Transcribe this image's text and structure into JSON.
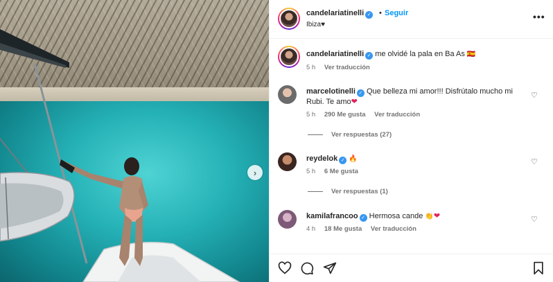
{
  "post": {
    "username": "candelariatinelli",
    "follow_label": "Seguir",
    "separator": "•",
    "location": "Ibiza♥",
    "more_label": "•••"
  },
  "caption": {
    "username": "candelariatinelli",
    "text": "me olvidé la pala en Ba As",
    "time": "5 h",
    "translate": "Ver traducción"
  },
  "comments": [
    {
      "username": "marcelotinelli",
      "text": "Que belleza mi amor!!! Disfrútalo mucho mi Rubi. Te amo",
      "time": "5 h",
      "likes": "290 Me gusta",
      "translate": "Ver traducción",
      "replies": "Ver respuestas (27)"
    },
    {
      "username": "reydelok",
      "text": "",
      "time": "5 h",
      "likes": "6 Me gusta",
      "replies": "Ver respuestas (1)"
    },
    {
      "username": "kamilafrancoo",
      "text": "Hermosa cande",
      "time": "4 h",
      "likes": "18 Me gusta",
      "translate": "Ver traducción"
    }
  ],
  "icons": {
    "like": "heart-outline-icon",
    "comment": "speech-bubble-icon",
    "share": "paper-plane-icon",
    "save": "bookmark-icon",
    "next": "chevron-right-icon",
    "verified": "verified-badge-icon"
  },
  "colors": {
    "accent": "#0095f6",
    "verified": "#3897f0",
    "muted": "#737373",
    "text": "#262626"
  }
}
